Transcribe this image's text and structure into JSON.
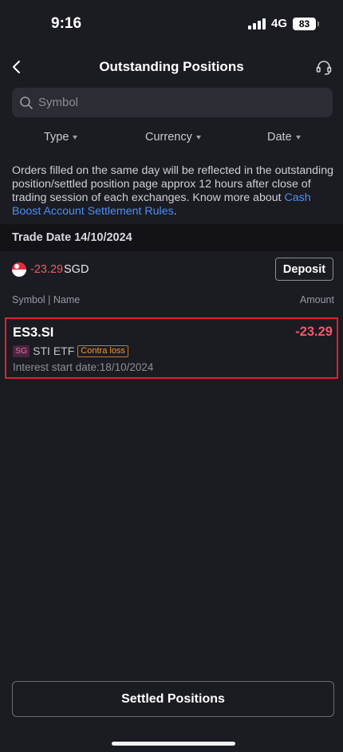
{
  "status_bar": {
    "time": "9:16",
    "network": "4G",
    "battery": "83"
  },
  "header": {
    "title": "Outstanding Positions",
    "back_icon": "chevron-left-icon",
    "support_icon": "headset-icon"
  },
  "search": {
    "placeholder": "Symbol",
    "value": ""
  },
  "filters": [
    {
      "label": "Type"
    },
    {
      "label": "Currency"
    },
    {
      "label": "Date"
    }
  ],
  "notice": {
    "text": "Orders filled on the same day will be reflected in the outstanding position/settled position page approx 12 hours after close of trading session of each exchanges.  Know more about ",
    "link_text": "Cash Boost Account Settlement Rules",
    "end": "."
  },
  "trade_group": {
    "date_label": "Trade Date 14/10/2024",
    "balance_amount": "-23.29",
    "balance_currency": "SGD",
    "deposit_label": "Deposit"
  },
  "columns": {
    "left": "Symbol | Name",
    "right": "Amount"
  },
  "positions": [
    {
      "symbol": "ES3.SI",
      "amount": "-23.29",
      "market": "SG",
      "name": "STI ETF",
      "tag": "Contra loss",
      "interest": "Interest start date:18/10/2024"
    }
  ],
  "footer": {
    "settled_label": "Settled Positions"
  },
  "colors": {
    "background": "#1b1b22",
    "negative": "#f0596a",
    "link": "#4d8ff5",
    "highlight_border": "#e02030"
  }
}
